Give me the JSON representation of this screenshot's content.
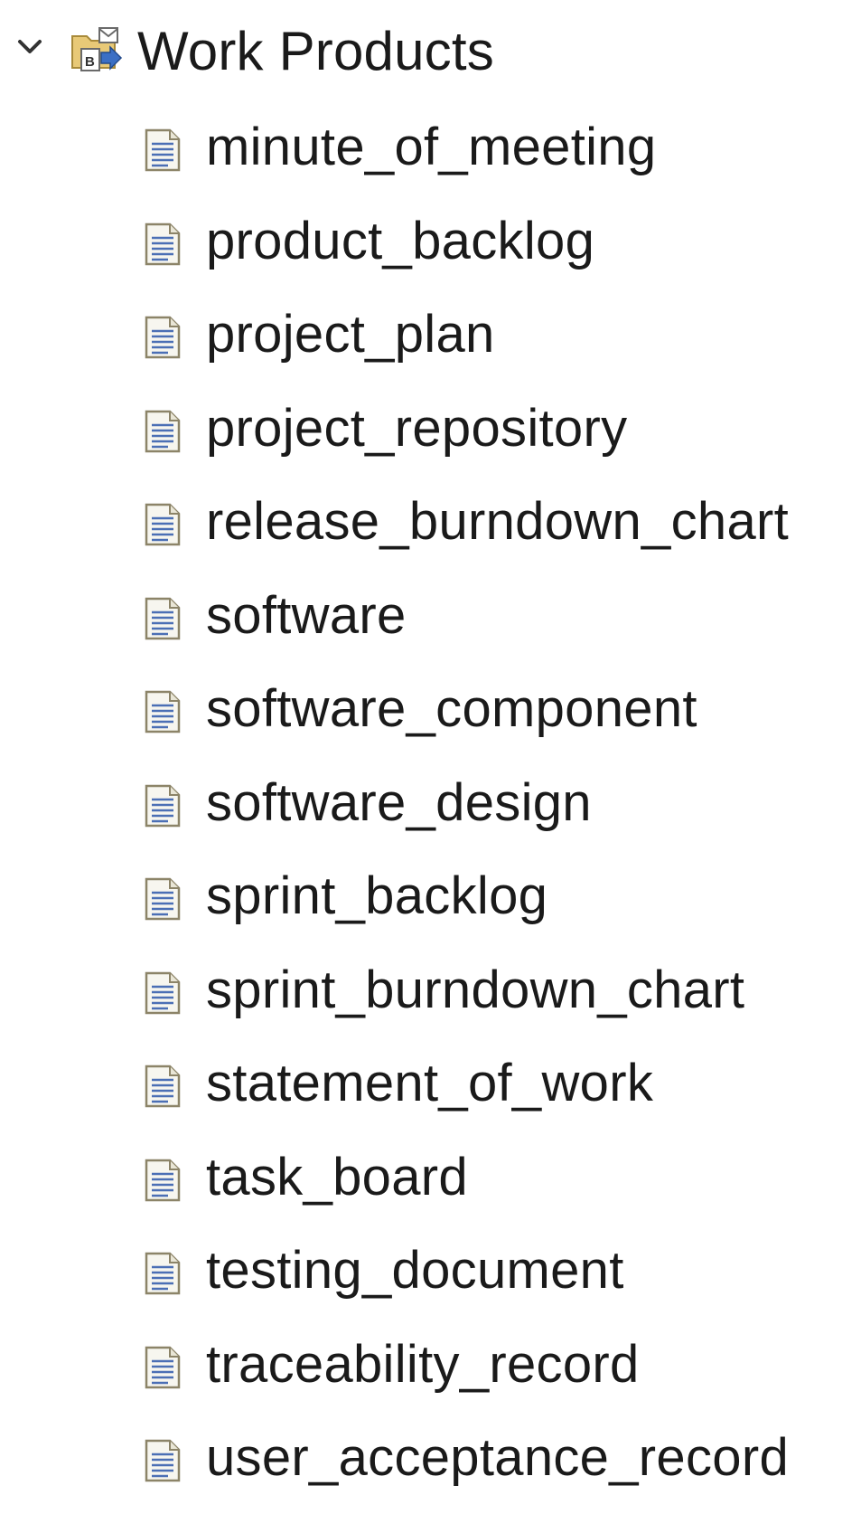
{
  "tree": {
    "root": {
      "label": "Work Products",
      "expanded": true,
      "chevron_icon": "chevron-down-icon",
      "icon": "work-products-folder-icon"
    },
    "items": [
      {
        "label": "minute_of_meeting",
        "icon": "document-icon"
      },
      {
        "label": "product_backlog",
        "icon": "document-icon"
      },
      {
        "label": "project_plan",
        "icon": "document-icon"
      },
      {
        "label": "project_repository",
        "icon": "document-icon"
      },
      {
        "label": "release_burndown_chart",
        "icon": "document-icon"
      },
      {
        "label": "software",
        "icon": "document-icon"
      },
      {
        "label": "software_component",
        "icon": "document-icon"
      },
      {
        "label": "software_design",
        "icon": "document-icon"
      },
      {
        "label": "sprint_backlog",
        "icon": "document-icon"
      },
      {
        "label": "sprint_burndown_chart",
        "icon": "document-icon"
      },
      {
        "label": "statement_of_work",
        "icon": "document-icon"
      },
      {
        "label": "task_board",
        "icon": "document-icon"
      },
      {
        "label": "testing_document",
        "icon": "document-icon"
      },
      {
        "label": "traceability_record",
        "icon": "document-icon"
      },
      {
        "label": "user_acceptance_record",
        "icon": "document-icon"
      }
    ]
  },
  "colors": {
    "text": "#1a1a1a",
    "chevron": "#333333",
    "doc_body": "#f7f6ef",
    "doc_border": "#8c8468",
    "doc_lines": "#4b6fb5",
    "folder": "#d9b45a",
    "folder_badge": "#3b6fc4"
  }
}
